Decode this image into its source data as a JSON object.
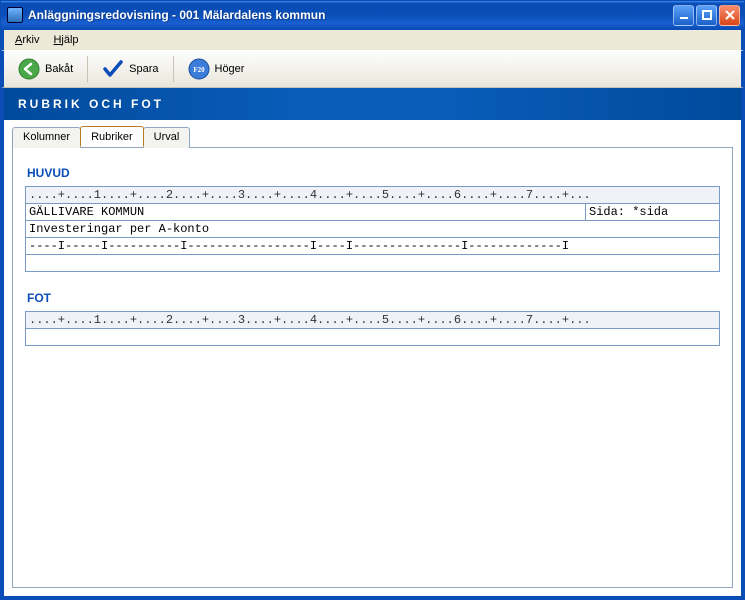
{
  "window": {
    "title": "Anläggningsredovisning  -  001 Mälardalens kommun"
  },
  "menubar": {
    "arkiv": "Arkiv",
    "hjalp": "Hjälp"
  },
  "toolbar": {
    "back_label": "Bakåt",
    "save_label": "Spara",
    "next_label": "Höger",
    "f20_badge": "F20"
  },
  "banner": {
    "title": "RUBRIK OCH FOT"
  },
  "tabs": {
    "kolumner": "Kolumner",
    "rubriker": "Rubriker",
    "urval": "Urval",
    "active": "rubriker"
  },
  "huvud": {
    "title": "HUVUD",
    "ruler": "....+....1....+....2....+....3....+....4....+....5....+....6....+....7....+...",
    "rows": [
      {
        "left": "GÄLLIVARE KOMMUN",
        "right": "Sida: *sida"
      },
      {
        "full": "Investeringar per A-konto"
      },
      {
        "full": "----I-----I----------I-----------------I----I---------------I-------------I"
      },
      {
        "full": ""
      }
    ]
  },
  "fot": {
    "title": "FOT",
    "ruler": "....+....1....+....2....+....3....+....4....+....5....+....6....+....7....+...",
    "rows": [
      {
        "full": ""
      }
    ]
  }
}
